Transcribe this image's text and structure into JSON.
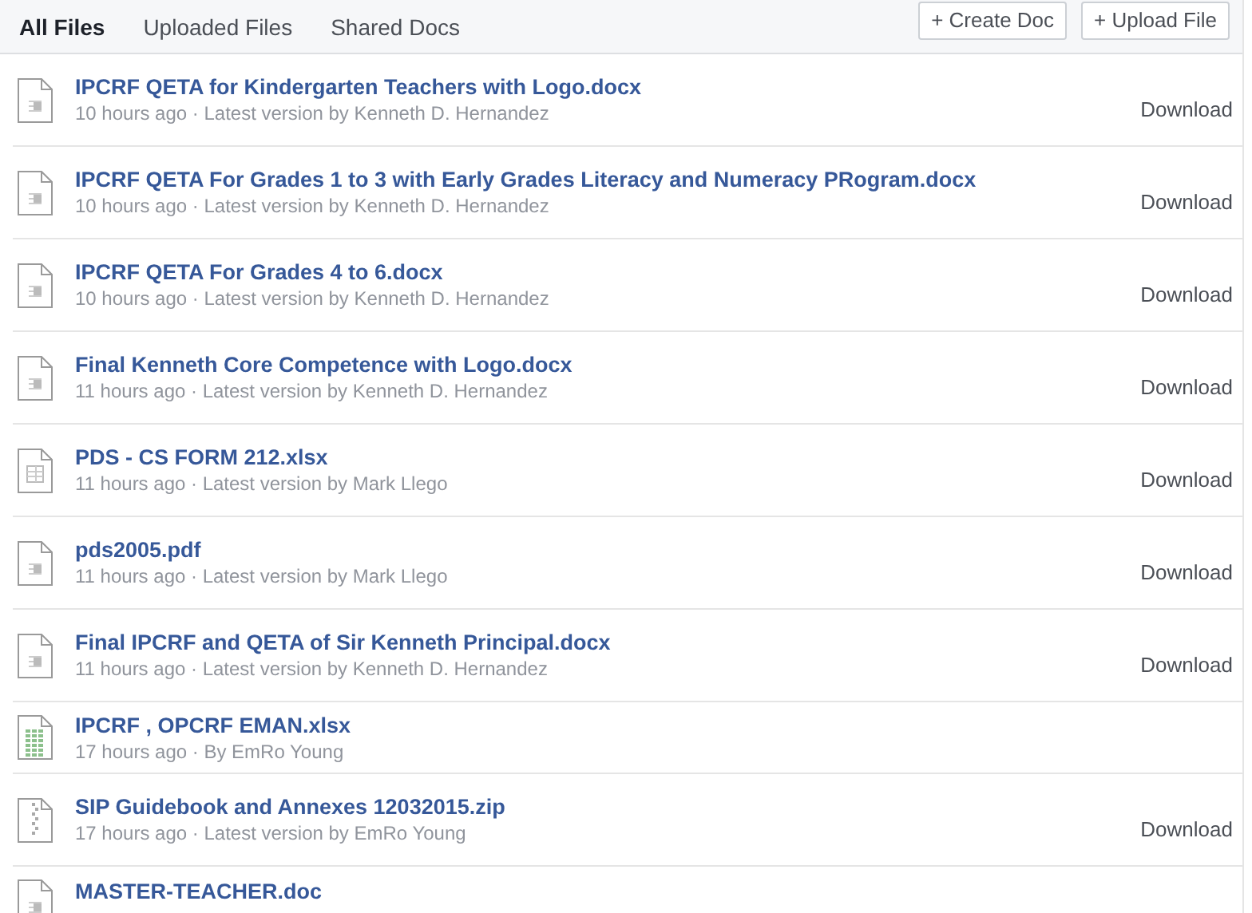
{
  "tabs": [
    {
      "label": "All Files",
      "selected": true
    },
    {
      "label": "Uploaded Files",
      "selected": false
    },
    {
      "label": "Shared Docs",
      "selected": false
    }
  ],
  "actions": [
    "+ Create Doc",
    "+ Upload File"
  ],
  "files": [
    {
      "kind": "document",
      "name": "IPCRF QETA for Kindergarten Teachers with Logo.docx",
      "meta": "10 hours ago · Latest version by Kenneth D. Hernandez",
      "download": "Download"
    },
    {
      "kind": "document",
      "name": "IPCRF QETA For Grades 1 to 3 with Early Grades Literacy and Numeracy PRogram.docx",
      "meta": "10 hours ago · Latest version by Kenneth D. Hernandez",
      "download": "Download"
    },
    {
      "kind": "document",
      "name": "IPCRF QETA For Grades 4 to 6.docx",
      "meta": "10 hours ago · Latest version by Kenneth D. Hernandez",
      "download": "Download"
    },
    {
      "kind": "document",
      "name": "Final Kenneth Core Competence with Logo.docx",
      "meta": "11 hours ago · Latest version by Kenneth D. Hernandez",
      "download": "Download"
    },
    {
      "kind": "spreadsheet",
      "name": "PDS - CS FORM 212.xlsx",
      "meta": "11 hours ago · Latest version by Mark Llego",
      "download": "Download"
    },
    {
      "kind": "document",
      "name": "pds2005.pdf",
      "meta": "11 hours ago · Latest version by Mark Llego",
      "download": "Download"
    },
    {
      "kind": "document",
      "name": "Final IPCRF and QETA of Sir Kenneth Principal.docx",
      "meta": "11 hours ago · Latest version by Kenneth D. Hernandez",
      "download": "Download"
    },
    {
      "kind": "sheet-preview",
      "name": "IPCRF , OPCRF EMAN.xlsx",
      "meta": "17 hours ago · By EmRo Young"
    },
    {
      "kind": "archive",
      "name": "SIP Guidebook and Annexes 12032015.zip",
      "meta": "17 hours ago · Latest version by EmRo Young",
      "download": "Download"
    },
    {
      "kind": "document",
      "name": "MASTER-TEACHER.doc"
    }
  ]
}
